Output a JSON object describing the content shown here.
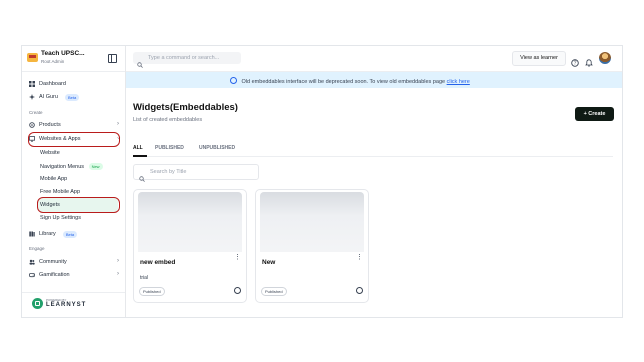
{
  "brand": {
    "title": "Teach UPSC...",
    "subtitle": "Root Admin"
  },
  "sidebar": {
    "dashboard": "Dashboard",
    "ai_guru": "AI Guru",
    "ai_guru_badge": "Beta",
    "create_section": "Create",
    "products": "Products",
    "websites_apps": "Websites & Apps",
    "sub_items": [
      "Website",
      "Navigation Menus",
      "Mobile App",
      "Free Mobile App",
      "Widgets",
      "Sign Up Settings"
    ],
    "nav_menus_badge": "New",
    "library": "Library",
    "library_badge": "Beta",
    "engage_section": "Engage",
    "community": "Community",
    "gamification": "Gamification",
    "powered_by": "POWERED BY",
    "powered_name": "LEARNYST"
  },
  "topbar": {
    "command_placeholder": "Type a command or search...",
    "view_as_learner": "View as learner"
  },
  "notice": {
    "text": "Old embeddables interface will be deprecated soon. To view old embeddables page",
    "link": "click here"
  },
  "main": {
    "title": "Widgets(Embeddables)",
    "subtitle": "List of created embeddables",
    "create_button": "+ Create",
    "tabs": [
      "ALL",
      "PUBLISHED",
      "UNPUBLISHED"
    ],
    "search_placeholder": "Search by Title",
    "cards": [
      {
        "title": "new embed",
        "description": "trial",
        "status": "Published"
      },
      {
        "title": "New",
        "description": "",
        "status": "Published"
      }
    ]
  },
  "colors": {
    "accent_dark": "#0f1a14",
    "highlight": "#b91c1c",
    "notice_bg": "#e0f2fe",
    "link": "#2563eb"
  }
}
